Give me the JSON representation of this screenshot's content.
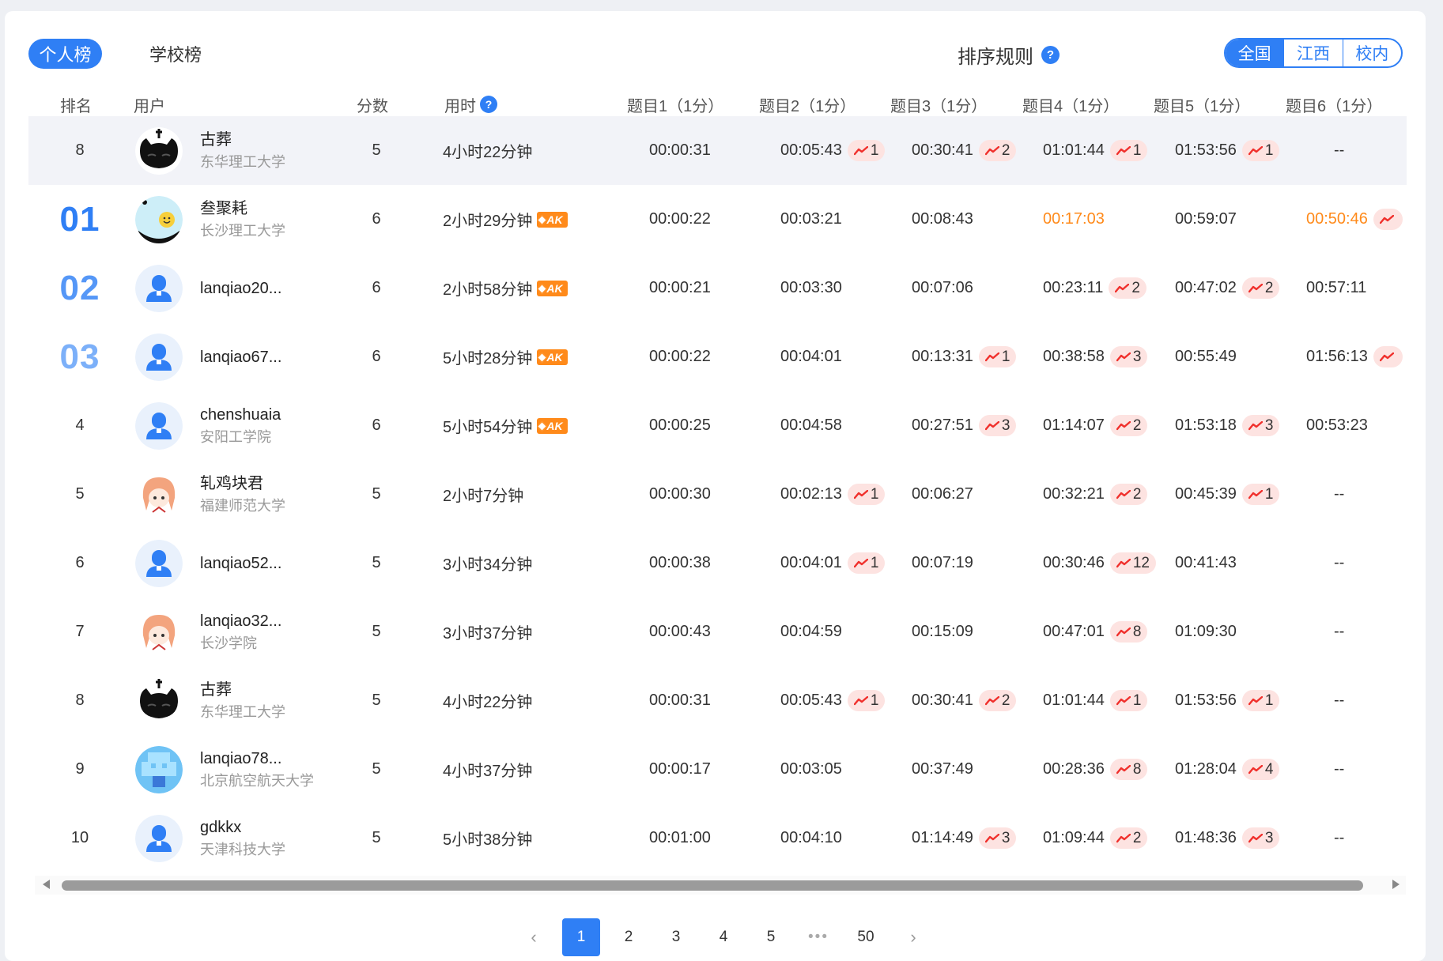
{
  "tabs": {
    "personal": "个人榜",
    "school": "学校榜"
  },
  "sort_rule": "排序规则",
  "help_glyph": "?",
  "scope": [
    "全国",
    "江西",
    "校内"
  ],
  "columns": {
    "rank": "排名",
    "user": "用户",
    "score": "分数",
    "time": "用时",
    "q1": "题目1（1分）",
    "q2": "题目2（1分）",
    "q3": "题目3（1分）",
    "q4": "题目4（1分）",
    "q5": "题目5（1分）",
    "q6": "题目6（1分）"
  },
  "ak_label": "AK",
  "colors": {
    "accent": "#2f7ff5",
    "orange": "#ff8a1a",
    "tries_bg": "#fde3e1",
    "trend": "#f0302c"
  },
  "rows": [
    {
      "rank": "8",
      "name": "古葬",
      "school": "东华理工大学",
      "score": "5",
      "time": "4小时22分钟",
      "ak": false,
      "q": [
        {
          "t": "00:00:31"
        },
        {
          "t": "00:05:43",
          "n": "1"
        },
        {
          "t": "00:30:41",
          "n": "2"
        },
        {
          "t": "01:01:44",
          "n": "1"
        },
        {
          "t": "01:53:56",
          "n": "1"
        },
        {
          "t": "--"
        }
      ]
    },
    {
      "rank": "01",
      "name": "叁聚耗",
      "school": "长沙理工大学",
      "score": "6",
      "time": "2小时29分钟",
      "ak": true,
      "q": [
        {
          "t": "00:00:22"
        },
        {
          "t": "00:03:21"
        },
        {
          "t": "00:08:43"
        },
        {
          "t": "00:17:03",
          "first": true
        },
        {
          "t": "00:59:07"
        },
        {
          "t": "00:50:46",
          "first": true,
          "n": ""
        }
      ]
    },
    {
      "rank": "02",
      "name": "lanqiao20...",
      "school": "",
      "score": "6",
      "time": "2小时58分钟",
      "ak": true,
      "q": [
        {
          "t": "00:00:21"
        },
        {
          "t": "00:03:30"
        },
        {
          "t": "00:07:06"
        },
        {
          "t": "00:23:11",
          "n": "2"
        },
        {
          "t": "00:47:02",
          "n": "2"
        },
        {
          "t": "00:57:11"
        }
      ]
    },
    {
      "rank": "03",
      "name": "lanqiao67...",
      "school": "",
      "score": "6",
      "time": "5小时28分钟",
      "ak": true,
      "q": [
        {
          "t": "00:00:22"
        },
        {
          "t": "00:04:01"
        },
        {
          "t": "00:13:31",
          "n": "1"
        },
        {
          "t": "00:38:58",
          "n": "3"
        },
        {
          "t": "00:55:49"
        },
        {
          "t": "01:56:13",
          "n": ""
        }
      ]
    },
    {
      "rank": "4",
      "name": "chenshuaia",
      "school": "安阳工学院",
      "score": "6",
      "time": "5小时54分钟",
      "ak": true,
      "q": [
        {
          "t": "00:00:25"
        },
        {
          "t": "00:04:58"
        },
        {
          "t": "00:27:51",
          "n": "3"
        },
        {
          "t": "01:14:07",
          "n": "2"
        },
        {
          "t": "01:53:18",
          "n": "3"
        },
        {
          "t": "00:53:23"
        }
      ]
    },
    {
      "rank": "5",
      "name": "轧鸡块君",
      "school": "福建师范大学",
      "score": "5",
      "time": "2小时7分钟",
      "ak": false,
      "q": [
        {
          "t": "00:00:30"
        },
        {
          "t": "00:02:13",
          "n": "1"
        },
        {
          "t": "00:06:27"
        },
        {
          "t": "00:32:21",
          "n": "2"
        },
        {
          "t": "00:45:39",
          "n": "1"
        },
        {
          "t": "--"
        }
      ]
    },
    {
      "rank": "6",
      "name": "lanqiao52...",
      "school": "",
      "score": "5",
      "time": "3小时34分钟",
      "ak": false,
      "q": [
        {
          "t": "00:00:38"
        },
        {
          "t": "00:04:01",
          "n": "1"
        },
        {
          "t": "00:07:19"
        },
        {
          "t": "00:30:46",
          "n": "12"
        },
        {
          "t": "00:41:43"
        },
        {
          "t": "--"
        }
      ]
    },
    {
      "rank": "7",
      "name": "lanqiao32...",
      "school": "长沙学院",
      "score": "5",
      "time": "3小时37分钟",
      "ak": false,
      "q": [
        {
          "t": "00:00:43"
        },
        {
          "t": "00:04:59"
        },
        {
          "t": "00:15:09"
        },
        {
          "t": "00:47:01",
          "n": "8"
        },
        {
          "t": "01:09:30"
        },
        {
          "t": "--"
        }
      ]
    },
    {
      "rank": "8",
      "name": "古葬",
      "school": "东华理工大学",
      "score": "5",
      "time": "4小时22分钟",
      "ak": false,
      "q": [
        {
          "t": "00:00:31"
        },
        {
          "t": "00:05:43",
          "n": "1"
        },
        {
          "t": "00:30:41",
          "n": "2"
        },
        {
          "t": "01:01:44",
          "n": "1"
        },
        {
          "t": "01:53:56",
          "n": "1"
        },
        {
          "t": "--"
        }
      ]
    },
    {
      "rank": "9",
      "name": "lanqiao78...",
      "school": "北京航空航天大学",
      "score": "5",
      "time": "4小时37分钟",
      "ak": false,
      "q": [
        {
          "t": "00:00:17"
        },
        {
          "t": "00:03:05"
        },
        {
          "t": "00:37:49"
        },
        {
          "t": "00:28:36",
          "n": "8"
        },
        {
          "t": "01:28:04",
          "n": "4"
        },
        {
          "t": "--"
        }
      ]
    },
    {
      "rank": "10",
      "name": "gdkkx",
      "school": "天津科技大学",
      "score": "5",
      "time": "5小时38分钟",
      "ak": false,
      "q": [
        {
          "t": "00:01:00"
        },
        {
          "t": "00:04:10"
        },
        {
          "t": "01:14:49",
          "n": "3"
        },
        {
          "t": "01:09:44",
          "n": "2"
        },
        {
          "t": "01:48:36",
          "n": "3"
        },
        {
          "t": "--"
        }
      ]
    }
  ],
  "avatars": [
    "cat",
    "smiley",
    "default",
    "default",
    "default",
    "anime",
    "default",
    "anime",
    "cat",
    "pixel",
    "default"
  ],
  "pagination": {
    "prev": "‹",
    "next": "›",
    "pages": [
      "1",
      "2",
      "3",
      "4",
      "5"
    ],
    "ellipsis": "•••",
    "last": "50",
    "current": "1"
  }
}
